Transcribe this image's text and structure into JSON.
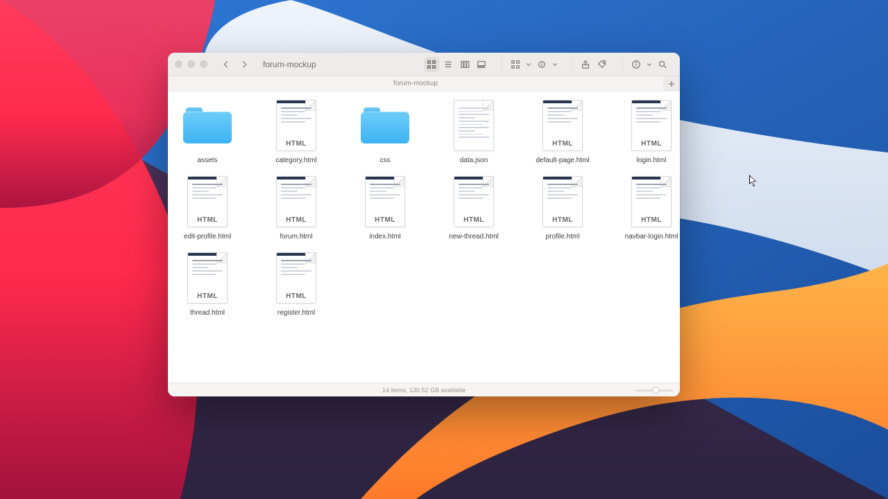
{
  "window": {
    "title": "forum-mockup",
    "tab_label": "forum-mockup",
    "status": "14 items, 130.52 GB available"
  },
  "items": [
    {
      "name": "assets",
      "kind": "folder"
    },
    {
      "name": "category.html",
      "kind": "html"
    },
    {
      "name": "css",
      "kind": "folder"
    },
    {
      "name": "data.json",
      "kind": "text"
    },
    {
      "name": "default-page.html",
      "kind": "html"
    },
    {
      "name": "login.html",
      "kind": "html"
    },
    {
      "name": "edit-profile.html",
      "kind": "html"
    },
    {
      "name": "forum.html",
      "kind": "html"
    },
    {
      "name": "index.html",
      "kind": "html"
    },
    {
      "name": "new-thread.html",
      "kind": "html"
    },
    {
      "name": "profile.html",
      "kind": "html"
    },
    {
      "name": "navbar-login.html",
      "kind": "html"
    },
    {
      "name": "thread.html",
      "kind": "html"
    },
    {
      "name": "register.html",
      "kind": "html"
    }
  ],
  "badges": {
    "html": "HTML"
  }
}
